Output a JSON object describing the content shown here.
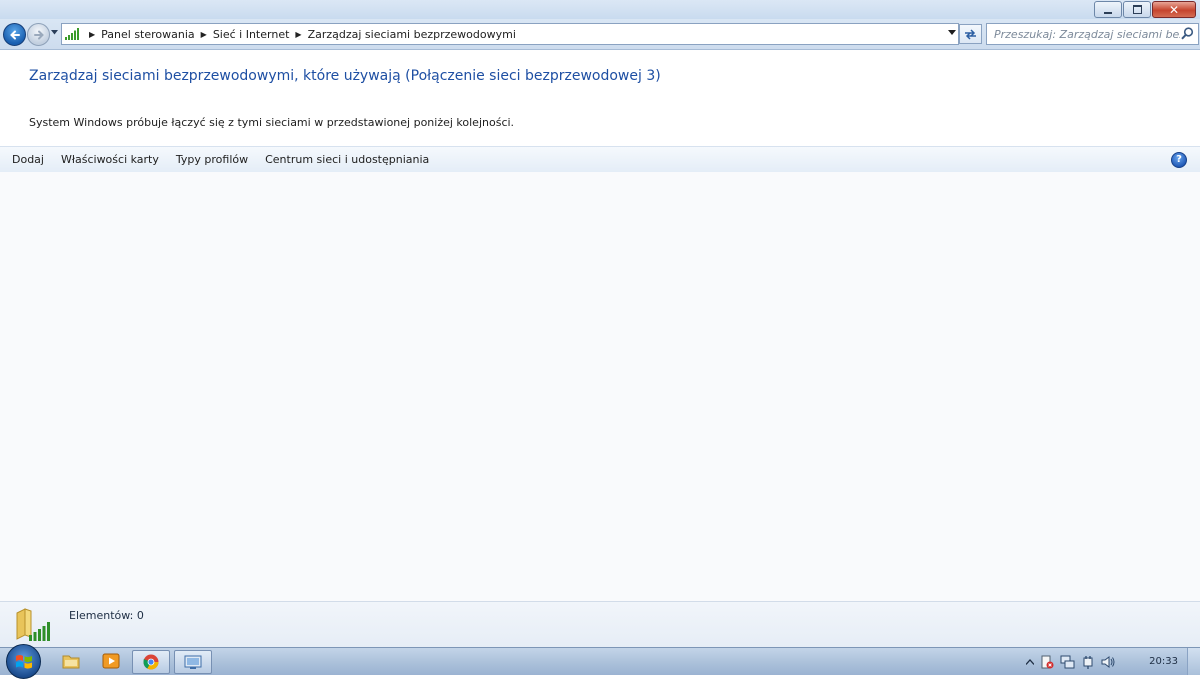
{
  "window": {
    "controls": {
      "minimize": "minimize-icon",
      "restore": "restore-icon",
      "close": "close-icon"
    }
  },
  "navigation": {
    "back": "back-arrow-icon",
    "forward": "forward-arrow-icon",
    "breadcrumb": [
      "Panel sterowania",
      "Sieć i Internet",
      "Zarządzaj sieciami bezprzewodowymi"
    ],
    "search_placeholder": "Przeszukaj: Zarządzaj sieciami bezprz..."
  },
  "content": {
    "title": "Zarządzaj sieciami bezprzewodowymi, które używają (Połączenie sieci bezprzewodowej 3)",
    "description": "System Windows próbuje łączyć się z tymi sieciami w przedstawionej poniżej kolejności."
  },
  "toolbar": {
    "items": [
      "Dodaj",
      "Właściwości karty",
      "Typy profilów",
      "Centrum sieci i udostępniania"
    ],
    "help": "?"
  },
  "details": {
    "items_count": "Elementów: 0"
  },
  "taskbar": {
    "apps": [
      "windows-explorer-icon",
      "media-player-icon",
      "chrome-icon",
      "network-window-icon"
    ],
    "clock": "20:33"
  },
  "colors": {
    "title_blue": "#1e4fa3",
    "chrome_blue": "#cddcee",
    "close_red": "#c6452e"
  }
}
